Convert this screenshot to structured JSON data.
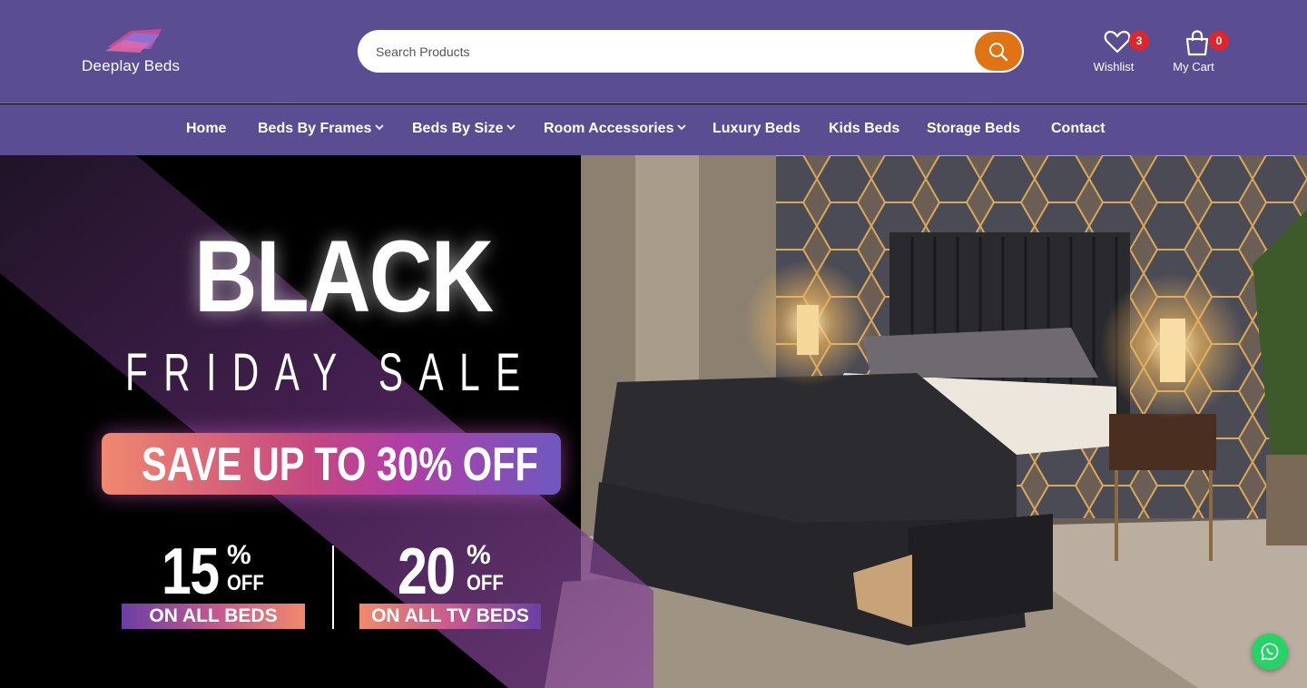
{
  "header": {
    "logo_text": "Deeplay Beds",
    "search": {
      "placeholder": "Search Products"
    },
    "wishlist": {
      "label": "Wishlist",
      "count": "3"
    },
    "cart": {
      "label": "My Cart",
      "count": "0"
    }
  },
  "nav": {
    "items": [
      {
        "label": "Home",
        "has_dropdown": false
      },
      {
        "label": "Beds By Frames",
        "has_dropdown": true
      },
      {
        "label": "Beds By Size",
        "has_dropdown": true
      },
      {
        "label": "Room Accessories",
        "has_dropdown": true
      },
      {
        "label": "Luxury Beds",
        "has_dropdown": false
      },
      {
        "label": "Kids Beds",
        "has_dropdown": false
      },
      {
        "label": "Storage Beds",
        "has_dropdown": false
      },
      {
        "label": "Contact",
        "has_dropdown": false
      }
    ]
  },
  "hero": {
    "headline": "BLACK",
    "subheadline": "FRIDAY SALE",
    "save_banner": "SAVE UP TO 30% OFF",
    "offers": [
      {
        "value": "15",
        "symbol": "%",
        "suffix": "OFF",
        "label": "ON ALL BEDS"
      },
      {
        "value": "20",
        "symbol": "%",
        "suffix": "OFF",
        "label": "ON ALL TV BEDS"
      }
    ]
  },
  "icons": {
    "search": "search-icon",
    "wishlist": "heart-icon",
    "cart": "shopping-bag-icon",
    "dropdown": "chevron-down-icon",
    "whatsapp": "whatsapp-icon"
  },
  "colors": {
    "header_bg": "#5b4d92",
    "search_button": "#e07313",
    "badge": "#e0262b",
    "whatsapp": "#25d366"
  }
}
